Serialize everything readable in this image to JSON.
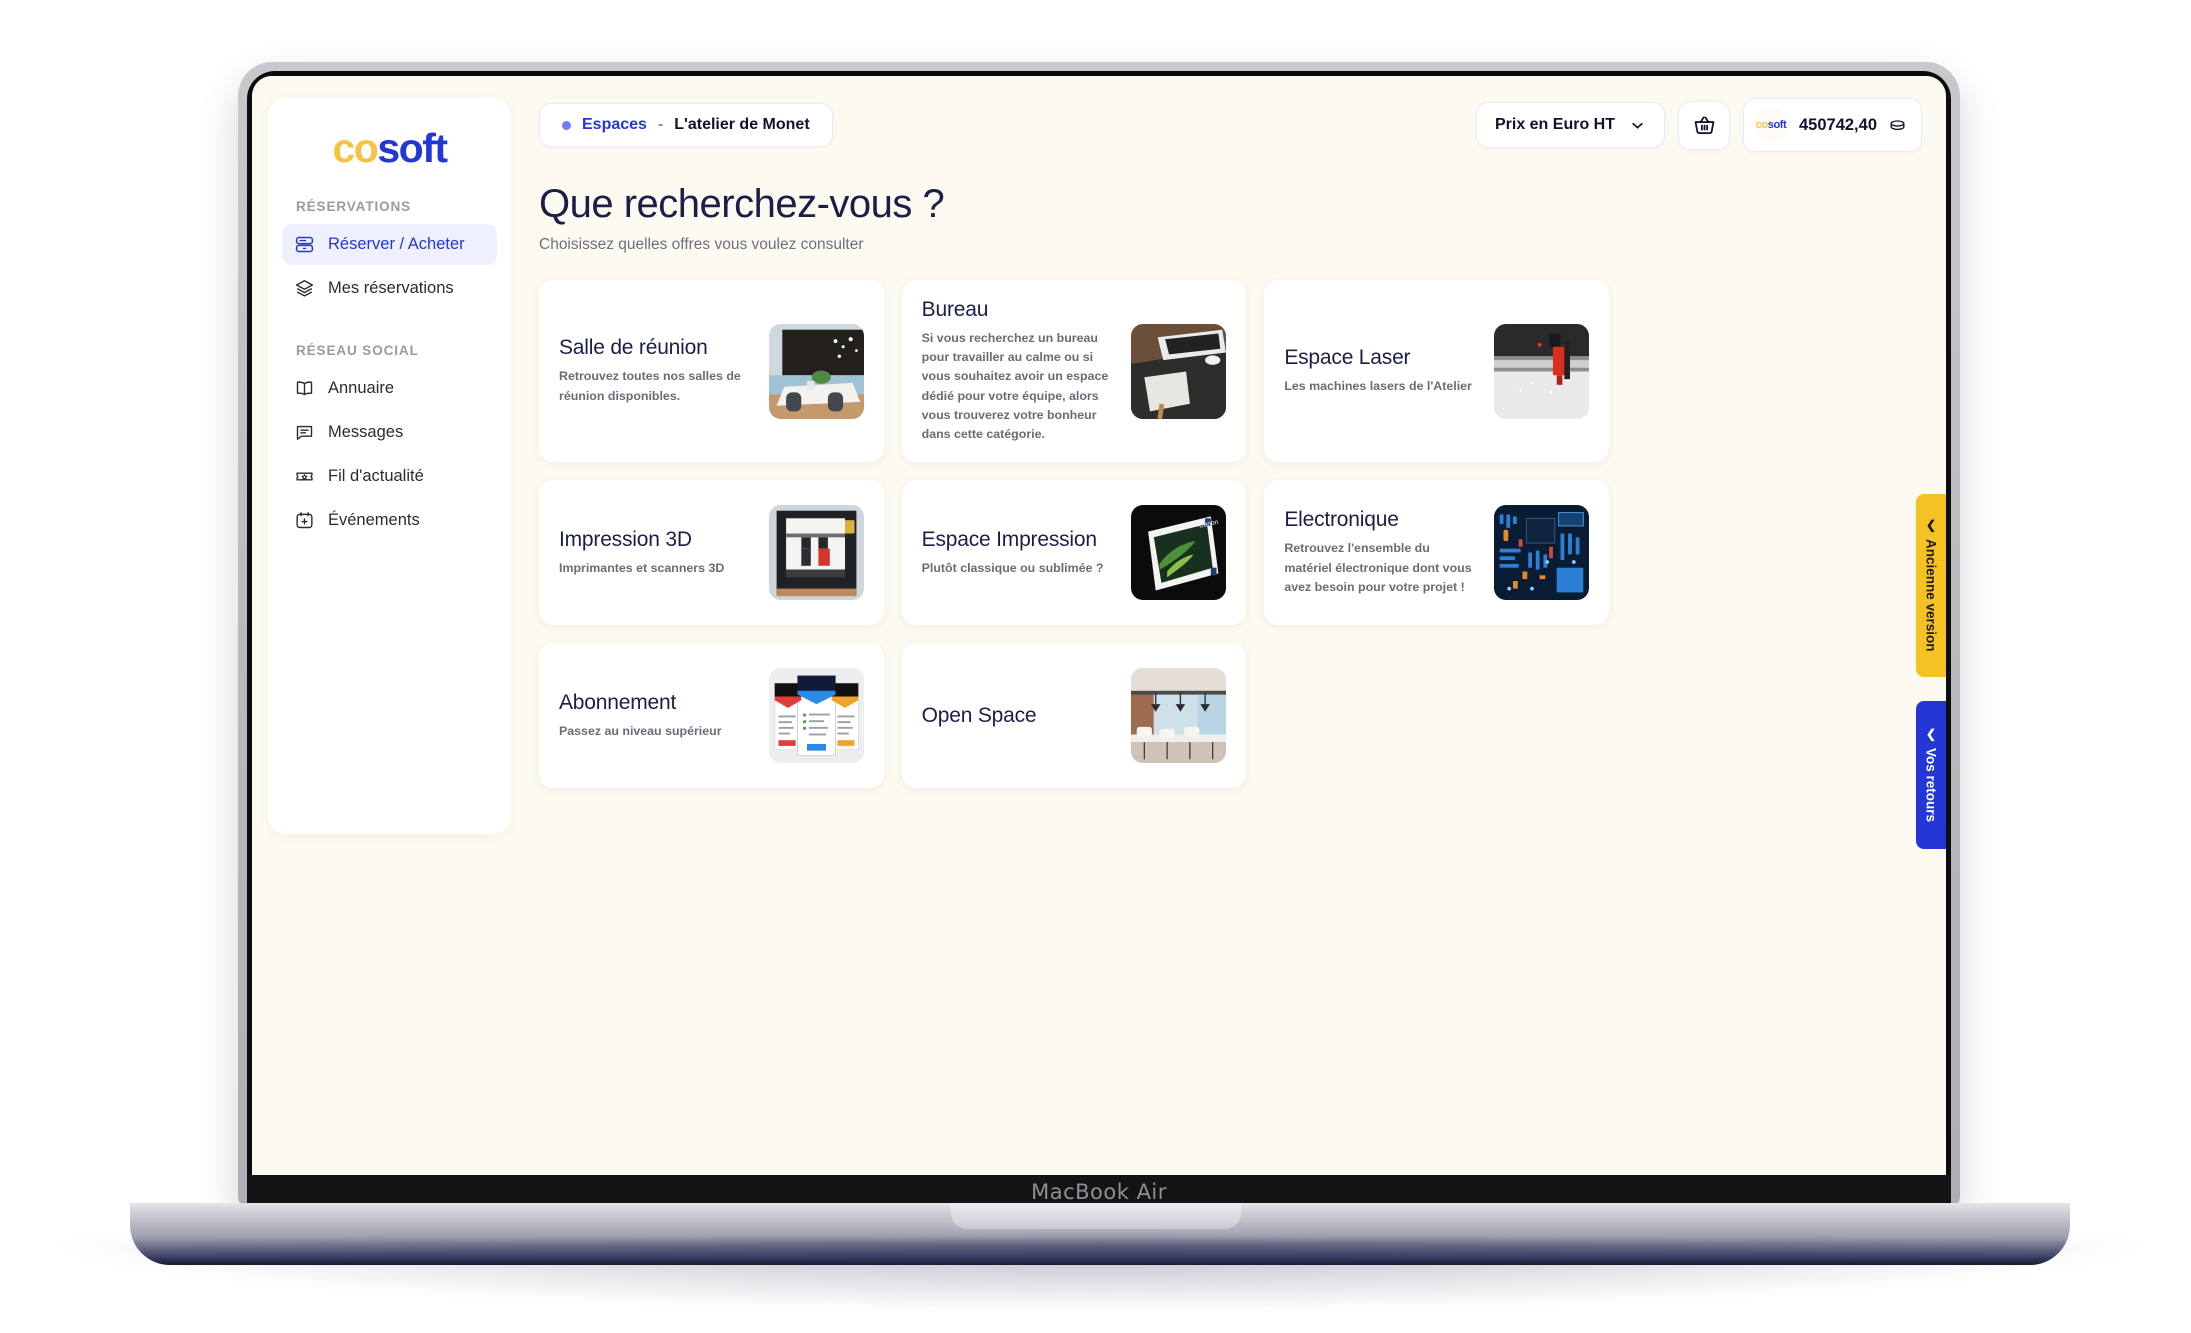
{
  "device": {
    "label": "MacBook Air"
  },
  "brand": {
    "logo_co": "co",
    "logo_soft": "soft",
    "color_yellow": "#f6c344",
    "color_blue": "#2337d6"
  },
  "sidebar": {
    "sections": [
      {
        "title": "RÉSERVATIONS",
        "items": [
          {
            "label": "Réserver / Acheter",
            "icon": "server-icon",
            "active": true
          },
          {
            "label": "Mes réservations",
            "icon": "layers-icon",
            "active": false
          }
        ]
      },
      {
        "title": "RÉSEAU SOCIAL",
        "items": [
          {
            "label": "Annuaire",
            "icon": "book-icon",
            "active": false
          },
          {
            "label": "Messages",
            "icon": "message-icon",
            "active": false
          },
          {
            "label": "Fil d'actualité",
            "icon": "ticket-star-icon",
            "active": false
          },
          {
            "label": "Événements",
            "icon": "calendar-plus-icon",
            "active": false
          }
        ]
      }
    ]
  },
  "topbar": {
    "breadcrumb": {
      "root": "Espaces",
      "separator": "-",
      "current": "L'atelier de Monet"
    },
    "price_select": {
      "label": "Prix en Euro HT"
    },
    "cart": {
      "icon": "basket-icon"
    },
    "balance": {
      "amount": "450742,40",
      "currency_icon": "coin-icon"
    }
  },
  "page": {
    "title": "Que recherchez-vous ?",
    "subtitle": "Choisissez quelles offres vous voulez consulter"
  },
  "cards": [
    {
      "title": "Salle de réunion",
      "desc": "Retrouvez toutes nos salles de réunion disponibles.",
      "thumb": "meeting-room-photo"
    },
    {
      "title": "Bureau",
      "desc": "Si vous recherchez un bureau pour travailler au calme ou si vous souhaitez avoir un espace dédié pour votre équipe, alors vous trouverez votre bonheur dans cette catégorie.",
      "thumb": "desk-laptop-photo"
    },
    {
      "title": "Espace Laser",
      "desc": "Les machines lasers de l'Atelier",
      "thumb": "laser-machine-photo"
    },
    {
      "title": "Impression 3D",
      "desc": "Imprimantes et scanners 3D",
      "thumb": "printer-3d-photo"
    },
    {
      "title": "Espace Impression",
      "desc": "Plutôt classique ou sublimée ?",
      "thumb": "canon-printer-photo"
    },
    {
      "title": "Electronique",
      "desc": "Retrouvez l'ensemble du matériel électronique dont vous avez besoin pour votre projet !",
      "thumb": "circuit-board-photo"
    },
    {
      "title": "Abonnement",
      "desc": "Passez au niveau supérieur",
      "thumb": "pricing-plans-photo"
    },
    {
      "title": "Open Space",
      "desc": "",
      "thumb": "open-space-photo"
    }
  ],
  "side_tabs": {
    "old_version": {
      "label": "Ancienne version",
      "color": "#f5c225"
    },
    "feedback": {
      "label": "Vos retours",
      "color": "#2337d6"
    }
  }
}
